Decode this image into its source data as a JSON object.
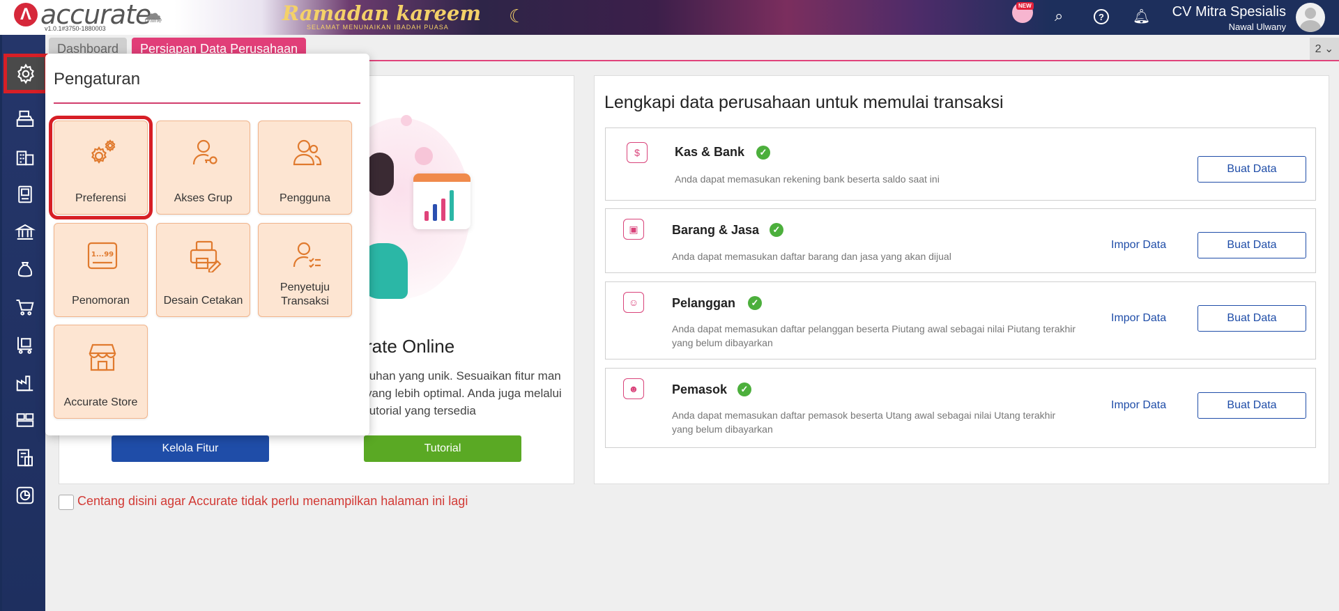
{
  "header": {
    "logo_text": "accurate",
    "logo_online": "online",
    "version": "v1.0.1#3750-1880003",
    "banner_title": "Ramadan kareem",
    "banner_subtitle": "SELAMAT MENUNAIKAN IBADAH PUASA",
    "new_badge": "NEW",
    "company_name": "CV Mitra Spesialis",
    "user_name": "Nawal Ulwany"
  },
  "tabs": [
    {
      "label": "Dashboard"
    },
    {
      "label": "Persiapan Data Perusahaan"
    }
  ],
  "tab_count": "2 ⌄",
  "welcome": {
    "title_partial": "rate Online",
    "desc_partial": "tuhan yang unik. Sesuaikan fitur man yang lebih optimal. Anda juga melalui tutorial yang tersedia",
    "btn_kelola": "Kelola Fitur",
    "btn_tutorial": "Tutorial"
  },
  "footer_checkbox_label": "Centang disini agar Accurate tidak perlu menampilkan halaman ini lagi",
  "setup": {
    "title": "Lengkapi data perusahaan untuk memulai transaksi",
    "impor_label": "Impor Data",
    "buat_label": "Buat Data",
    "rows": [
      {
        "title": "Kas & Bank",
        "desc": "Anda dapat memasukan rekening bank beserta saldo saat ini"
      },
      {
        "title": "Barang & Jasa",
        "desc": "Anda dapat memasukan daftar barang dan jasa yang akan dijual"
      },
      {
        "title": "Pelanggan",
        "desc": "Anda dapat memasukan daftar pelanggan beserta Piutang awal sebagai nilai Piutang terakhir yang belum dibayarkan"
      },
      {
        "title": "Pemasok",
        "desc": "Anda dapat memasukan daftar pemasok beserta Utang awal sebagai nilai Utang terakhir yang belum dibayarkan"
      }
    ]
  },
  "popup": {
    "title": "Pengaturan",
    "tiles": [
      {
        "label": "Preferensi",
        "icon": "gears-icon"
      },
      {
        "label": "Akses Grup",
        "icon": "user-key-icon"
      },
      {
        "label": "Pengguna",
        "icon": "users-icon"
      },
      {
        "label": "Penomoran",
        "icon": "numbering-icon"
      },
      {
        "label": "Desain Cetakan",
        "icon": "printer-edit-icon"
      },
      {
        "label": "Penyetuju Transaksi",
        "icon": "user-approval-icon"
      },
      {
        "label": "Accurate Store",
        "icon": "store-icon"
      }
    ],
    "accent_color": "#e07a2e"
  },
  "sidebar": {
    "items": [
      "settings-icon",
      "cashier-icon",
      "company-icon",
      "ledger-icon",
      "bank-icon",
      "tax-bag-icon",
      "cart-icon",
      "delivery-cart-icon",
      "factory-icon",
      "inventory-icon",
      "tax-doc-icon",
      "report-chart-icon"
    ]
  },
  "colors": {
    "brand_red": "#d71f26",
    "primary_blue": "#1f4da8",
    "success_green": "#5aa924",
    "tab_pink": "#e13e78"
  }
}
